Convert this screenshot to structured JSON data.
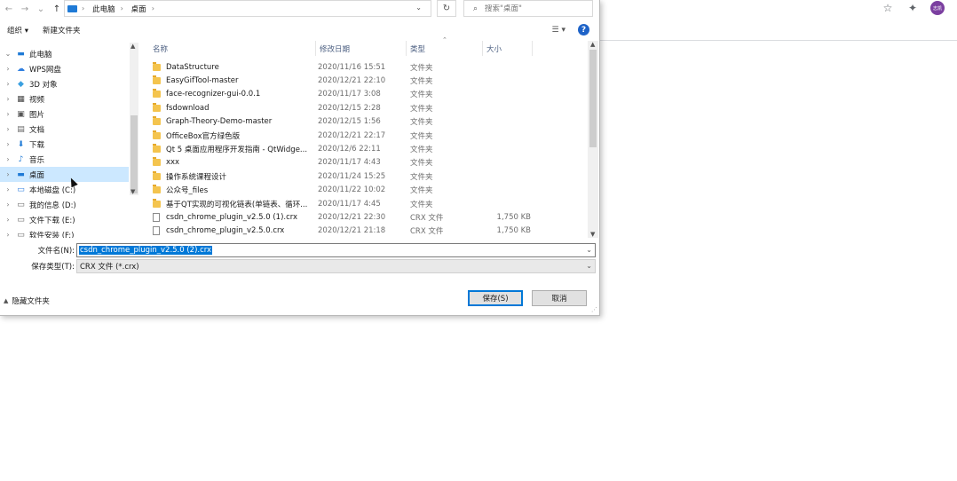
{
  "browser": {
    "avatar_text": "志凯",
    "icons": [
      "star-icon",
      "extensions-icon"
    ]
  },
  "nav": {
    "breadcrumb": [
      "此电脑",
      "桌面"
    ],
    "search_placeholder": "搜索\"桌面\""
  },
  "toolbar": {
    "organize": "组织 ▾",
    "new_folder": "新建文件夹"
  },
  "tree": [
    {
      "label": "此电脑",
      "icon": "computer-icon",
      "expanded": true
    },
    {
      "label": "WPS网盘",
      "icon": "cloud-icon"
    },
    {
      "label": "3D 对象",
      "icon": "cube-icon"
    },
    {
      "label": "视频",
      "icon": "video-icon"
    },
    {
      "label": "图片",
      "icon": "picture-icon"
    },
    {
      "label": "文档",
      "icon": "document-icon"
    },
    {
      "label": "下载",
      "icon": "download-icon"
    },
    {
      "label": "音乐",
      "icon": "music-icon"
    },
    {
      "label": "桌面",
      "icon": "desktop-icon",
      "selected": true
    },
    {
      "label": "本地磁盘 (C:)",
      "icon": "drive-icon"
    },
    {
      "label": "我的信息 (D:)",
      "icon": "drive-icon"
    },
    {
      "label": "文件下载 (E:)",
      "icon": "drive-icon"
    },
    {
      "label": "软件安装 (F:)",
      "icon": "drive-icon"
    }
  ],
  "list": {
    "columns": [
      "名称",
      "修改日期",
      "类型",
      "大小"
    ],
    "rows": [
      {
        "name": "DataStructure",
        "date": "2020/11/16 15:51",
        "type": "文件夹",
        "size": "",
        "kind": "folder"
      },
      {
        "name": "EasyGifTool-master",
        "date": "2020/12/21 22:10",
        "type": "文件夹",
        "size": "",
        "kind": "folder"
      },
      {
        "name": "face-recognizer-gui-0.0.1",
        "date": "2020/11/17 3:08",
        "type": "文件夹",
        "size": "",
        "kind": "folder"
      },
      {
        "name": "fsdownload",
        "date": "2020/12/15 2:28",
        "type": "文件夹",
        "size": "",
        "kind": "folder"
      },
      {
        "name": "Graph-Theory-Demo-master",
        "date": "2020/12/15 1:56",
        "type": "文件夹",
        "size": "",
        "kind": "folder"
      },
      {
        "name": "OfficeBox官方绿色版",
        "date": "2020/12/21 22:17",
        "type": "文件夹",
        "size": "",
        "kind": "folder"
      },
      {
        "name": "Qt 5 桌面应用程序开发指南 - QtWidge...",
        "date": "2020/12/6 22:11",
        "type": "文件夹",
        "size": "",
        "kind": "folder"
      },
      {
        "name": "xxx",
        "date": "2020/11/17 4:43",
        "type": "文件夹",
        "size": "",
        "kind": "folder"
      },
      {
        "name": "操作系统课程设计",
        "date": "2020/11/24 15:25",
        "type": "文件夹",
        "size": "",
        "kind": "folder"
      },
      {
        "name": "公众号_files",
        "date": "2020/11/22 10:02",
        "type": "文件夹",
        "size": "",
        "kind": "folder"
      },
      {
        "name": "基于QT实现的可视化链表(单链表、循环...",
        "date": "2020/11/17 4:45",
        "type": "文件夹",
        "size": "",
        "kind": "folder"
      },
      {
        "name": "csdn_chrome_plugin_v2.5.0 (1).crx",
        "date": "2020/12/21 22:30",
        "type": "CRX 文件",
        "size": "1,750 KB",
        "kind": "file"
      },
      {
        "name": "csdn_chrome_plugin_v2.5.0.crx",
        "date": "2020/12/21 21:18",
        "type": "CRX 文件",
        "size": "1,750 KB",
        "kind": "file"
      }
    ]
  },
  "form": {
    "filename_label": "文件名(N):",
    "filename_value": "csdn_chrome_plugin_v2.5.0 (2).crx",
    "filetype_label": "保存类型(T):",
    "filetype_value": "CRX 文件 (*.crx)",
    "hide_folders": "隐藏文件夹",
    "save": "保存(S)",
    "cancel": "取消"
  }
}
